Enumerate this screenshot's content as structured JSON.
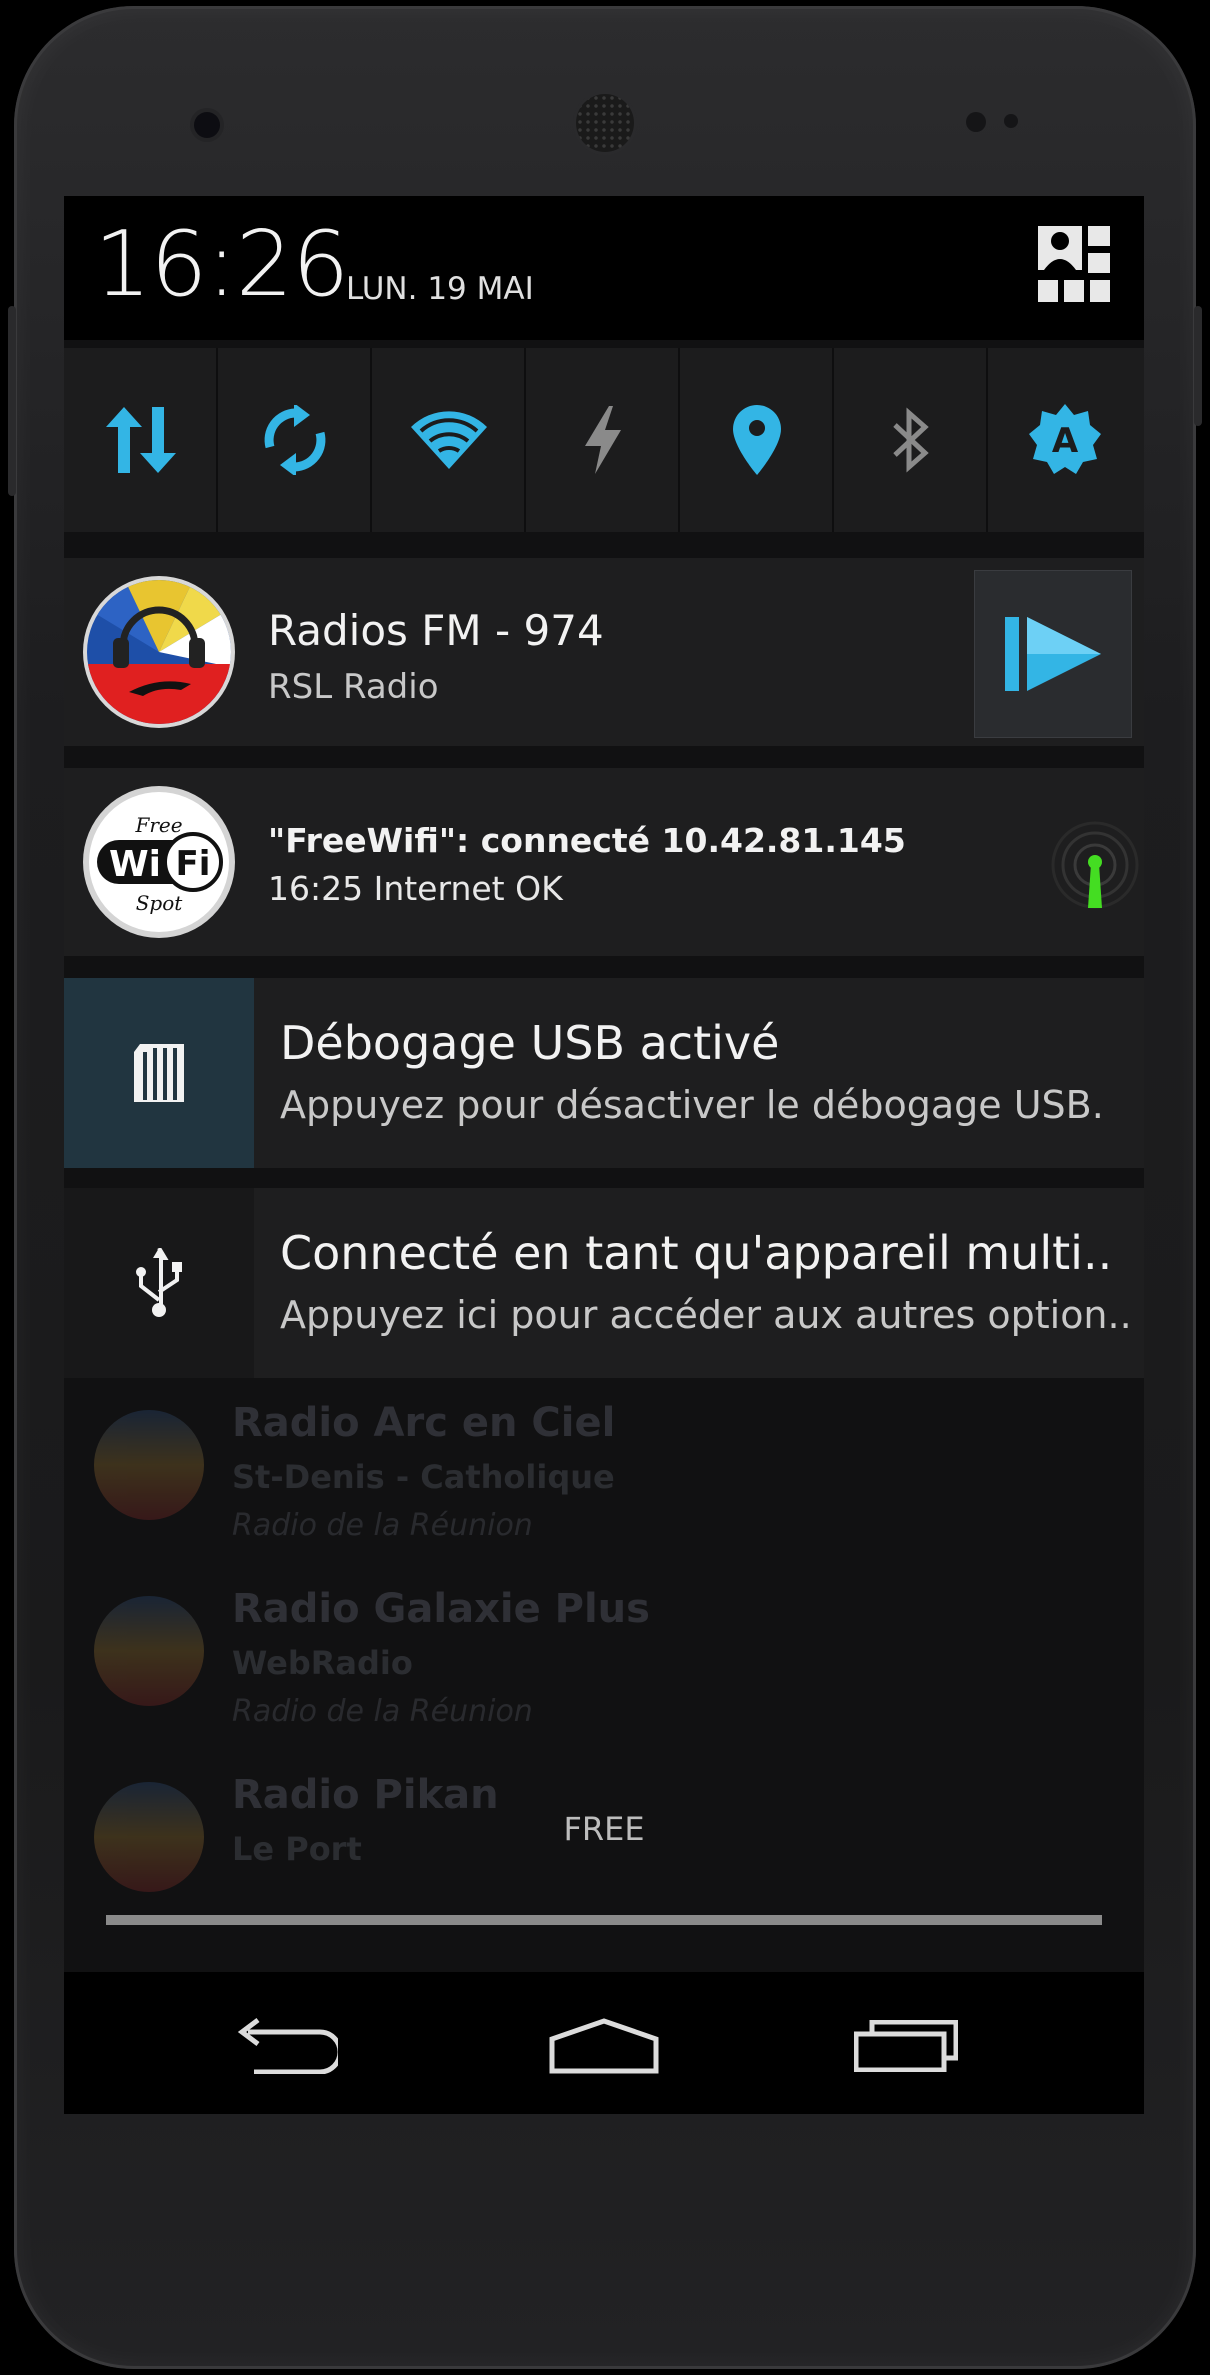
{
  "status": {
    "time": "16:26",
    "date": "LUN. 19 MAI"
  },
  "quick_settings": [
    {
      "icon": "data-arrows-icon",
      "color": "#33b5e5"
    },
    {
      "icon": "sync-icon",
      "color": "#33b5e5"
    },
    {
      "icon": "wifi-icon",
      "color": "#33b5e5"
    },
    {
      "icon": "flash-icon",
      "color": "#8a8a8a"
    },
    {
      "icon": "location-icon",
      "color": "#33b5e5"
    },
    {
      "icon": "bluetooth-icon",
      "color": "#8a8a8a"
    },
    {
      "icon": "auto-brightness-icon",
      "color": "#33b5e5",
      "glyph": "A"
    }
  ],
  "notifications": {
    "radio": {
      "title": "Radios FM - 974",
      "text": "RSL Radio"
    },
    "wifi": {
      "title": "\"FreeWifi\": connecté 10.42.81.145",
      "text": "16:25 Internet OK",
      "logo_free": "Free",
      "logo_wi": "Wi",
      "logo_fi": "Fi",
      "logo_spot": "Spot"
    },
    "usb_debug": {
      "title": "Débogage USB activé",
      "text": "Appuyez pour désactiver le débogage USB."
    },
    "usb_mode": {
      "title": "Connecté en tant qu'appareil multi..",
      "text": "Appuyez ici pour accéder aux autres option.."
    }
  },
  "background_list": [
    {
      "title": "Radio Arc en Ciel",
      "subtitle": "St-Denis - Catholique",
      "source": "Radio de la Réunion"
    },
    {
      "title": "Radio Galaxie Plus",
      "subtitle": "WebRadio",
      "source": "Radio de la Réunion"
    },
    {
      "title": "Radio Pikan",
      "subtitle": "Le Port",
      "source": ""
    }
  ],
  "carrier": "FREE",
  "colors": {
    "accent": "#33b5e5",
    "usb_debug_bg": "#213540",
    "wifi_signal": "#44dd22"
  }
}
